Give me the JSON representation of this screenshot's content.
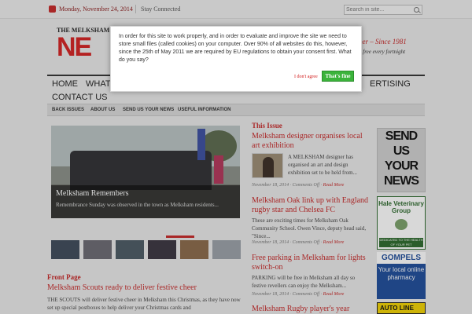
{
  "topbar": {
    "date": "Monday, November 24, 2014",
    "stay_connected": "Stay Connected",
    "search_placeholder": "Search in site..."
  },
  "header": {
    "logo_small": "THE MELKSHAM",
    "logo_big": "NE",
    "tagline": "per – Since 1981",
    "subtagline": "d free every fortnight"
  },
  "nav": {
    "items": [
      "HOME",
      "WHATS",
      "ERTISING",
      "CONTACT US"
    ]
  },
  "subnav": {
    "items": [
      "BACK ISSUES",
      "ABOUT US",
      "SEND US YOUR NEWS",
      "USEFUL INFORMATION"
    ]
  },
  "slider": {
    "title": "Melksham Remembers",
    "text": "Remembrance Sunday was observed in the town as Melksham residents..."
  },
  "front_page": {
    "label": "Front Page",
    "title": "Melksham Scouts ready to deliver festive cheer",
    "text": "THE SCOUTS will deliver festive cheer in Melksham this Christmas, as they have now set up special postboxes to help deliver your Christmas cards and"
  },
  "this_issue": {
    "label": "This Issue",
    "articles": [
      {
        "title": "Melksham designer organises local art exhibition",
        "text": "A MELKSHAM designer has organised an art and design exhibition set to be held from...",
        "date": "November 18, 2014",
        "comments": "Comments Off",
        "more": "Read More"
      },
      {
        "title": "Melksham Oak link up with England rugby star and Chelsea FC",
        "text": "These are exciting times for Melksham Oak Community School. Owen Vince, deputy head said, \"Since...",
        "date": "November 18, 2014",
        "comments": "Comments Off",
        "more": "Read More"
      },
      {
        "title": "Free parking in Melksham for lights switch-on",
        "text": "PARKING will be free in Melksham all day so festive revellers can enjoy the Melksham...",
        "date": "November 18, 2014",
        "comments": "Comments Off",
        "more": "Read More"
      },
      {
        "title": "Melksham Rugby player's year"
      }
    ]
  },
  "ads": {
    "send_news": [
      "SEND",
      "US",
      "YOUR",
      "NEWS"
    ],
    "vet_heading": "Hale Veterinary Group",
    "vet_banner": "DEDICATED TO THE HEALTH OF YOUR PET",
    "gompels_name": "GOMPELS",
    "gompels_text": "Your local online pharmacy",
    "auto": "AUTO LINE"
  },
  "cookie_modal": {
    "text": "In order for this site to work properly, and in order to evaluate and improve the site we need to store small files (called cookies) on your computer. Over 90% of all websites do this, however, since the 25th of May 2011 we are required by EU regulations to obtain your consent first. What do you say?",
    "decline": "I don't agree",
    "accept": "That's fine"
  }
}
